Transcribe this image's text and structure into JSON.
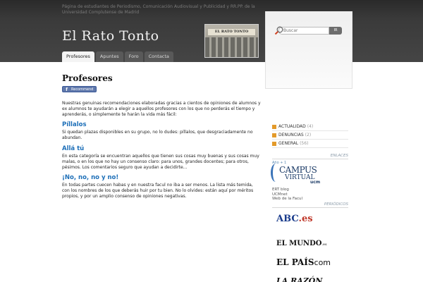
{
  "header": {
    "tagline": "Página de estudiantes de Periodismo, Comunicación Audiovisual y Publicidad y RR.PP. de la Universidad Complutense de Madrid",
    "site_title": "El Rato Tonto",
    "banner_text": "EL RATO TONTO"
  },
  "nav": {
    "tabs": [
      "Profesores",
      "Apuntes",
      "Foro",
      "Contacta"
    ],
    "active": "Profesores"
  },
  "search": {
    "placeholder": "Buscar",
    "button_label": "IR"
  },
  "content": {
    "title": "Profesores",
    "fb_button": "Recommend",
    "intro": "Nuestras genuinas recomendaciones elaboradas gracias a cientos de opiniones de alumnos y ex alumnos te ayudarán a elegir a aquellos profesores con los que no perderás el tiempo y aprenderás, o simplemente te harán la vida más fácil:",
    "sections": [
      {
        "heading": "Píllalos",
        "text": "Si quedan plazas disponibles en su grupo, no lo dudes: píllalos, que desgraciadamente no abundan."
      },
      {
        "heading": "Allá tú",
        "text": "En esta categoría se encuentran aquellos que tienen sus cosas muy buenas y sus cosas muy malas, o en los que no hay un consenso claro: para unos, grandes docentes; para otros, pésimos. Los comentarios seguro que ayudan a decidirte…"
      },
      {
        "heading": "¡No, no, no y no!",
        "text": "En todas partes cuecen habas y en nuestra facul no iba a ser menos. La lista más temida, con los nombres de los que deberás huir por tu bien. No lo olvides: están aquí por méritos propios, y por un amplio consenso de opiniones negativas."
      }
    ]
  },
  "sidebar": {
    "categories": [
      {
        "label": "ACTUALIDAD",
        "count": "(4)"
      },
      {
        "label": "DENUNCIAS",
        "count": "(2)"
      },
      {
        "label": "GENERAL",
        "count": "(56)"
      }
    ],
    "enlaces_heading": "ENLACES",
    "campus": {
      "year_label": "Año + 1",
      "line1": "CAMPUS",
      "line2": "VIRTUAL",
      "ucm": "ucm"
    },
    "links": [
      "ERT blog",
      "UCMnet",
      "Web de la Facul"
    ],
    "periodicos_heading": "PERIÓDICOS",
    "papers": {
      "abc_main": "ABC",
      "abc_ext": ".es",
      "mundo_main": "EL MUNDO",
      "mundo_ext": ".es",
      "pais_main": "EL PAÍS",
      "pais_ext": "com",
      "razon": "LA RAZÓN"
    }
  },
  "colors": {
    "header_bg": "#3a3a3a",
    "link_blue": "#1d6fb8",
    "category_bullet": "#e39a2a"
  }
}
